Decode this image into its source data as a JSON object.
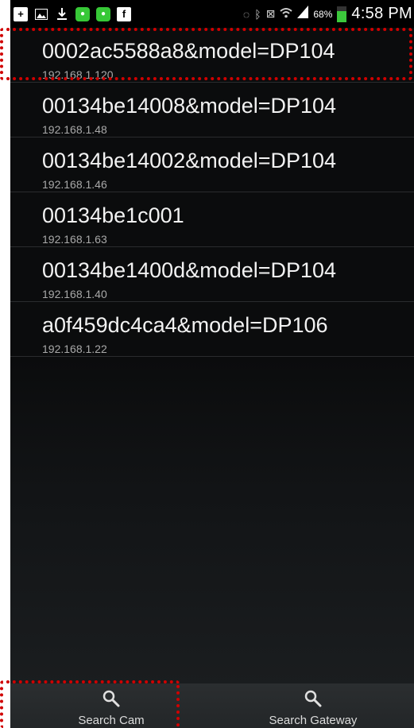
{
  "status_bar": {
    "battery_percent": "68%",
    "time": "4:58 PM",
    "icons": [
      "plus-icon",
      "gallery-icon",
      "download-icon",
      "chat-icon",
      "chat-icon",
      "facebook-icon",
      "eye-icon",
      "bluetooth-icon",
      "nfc-icon",
      "wifi-icon",
      "signal-icon",
      "battery-icon"
    ]
  },
  "devices": [
    {
      "name": "0002ac5588a8&model=DP104",
      "ip": "192.168.1.120"
    },
    {
      "name": "00134be14008&model=DP104",
      "ip": "192.168.1.48"
    },
    {
      "name": "00134be14002&model=DP104",
      "ip": "192.168.1.46"
    },
    {
      "name": "00134be1c001",
      "ip": "192.168.1.63"
    },
    {
      "name": "00134be1400d&model=DP104",
      "ip": "192.168.1.40"
    },
    {
      "name": "a0f459dc4ca4&model=DP106",
      "ip": "192.168.1.22"
    }
  ],
  "toolbar": {
    "search_cam_label": "Search Cam",
    "search_gateway_label": "Search Gateway"
  },
  "colors": {
    "highlight": "#d00000",
    "background": "#0b0c0d"
  }
}
